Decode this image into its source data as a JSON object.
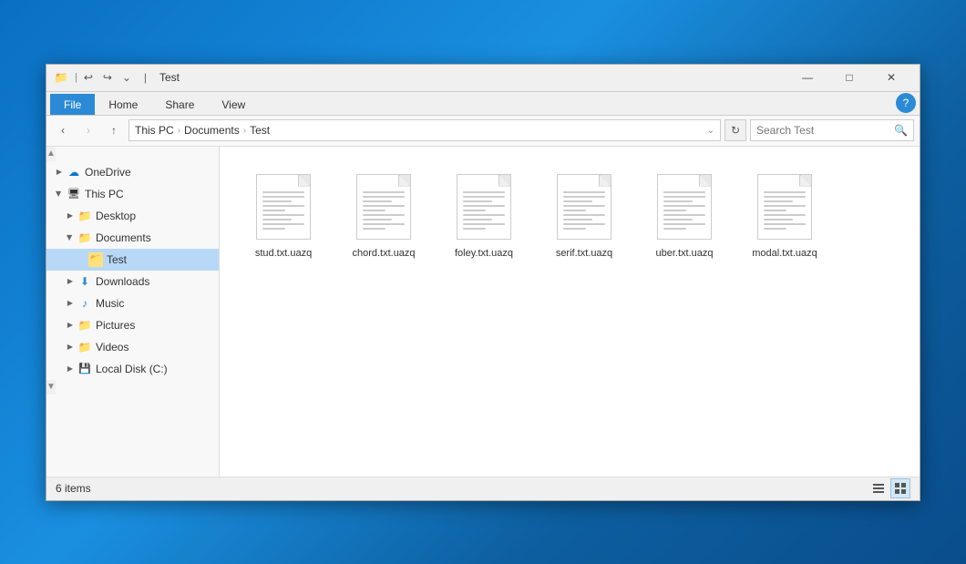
{
  "window": {
    "title": "Test",
    "title_icon": "📁"
  },
  "title_bar": {
    "quick_access": [
      "back",
      "forward",
      "down"
    ],
    "title": "Test"
  },
  "ribbon": {
    "tabs": [
      "File",
      "Home",
      "Share",
      "View"
    ],
    "active_tab": "File",
    "help_label": "?"
  },
  "nav": {
    "back_disabled": false,
    "forward_disabled": true,
    "up_disabled": false,
    "address": {
      "parts": [
        "This PC",
        "Documents",
        "Test"
      ],
      "separators": [
        "›",
        "›"
      ]
    },
    "search_placeholder": "Search Test"
  },
  "sidebar": {
    "items": [
      {
        "id": "onedrive",
        "label": "OneDrive",
        "indent": 1,
        "expanded": false,
        "icon": "cloud"
      },
      {
        "id": "thispc",
        "label": "This PC",
        "indent": 1,
        "expanded": true,
        "icon": "computer"
      },
      {
        "id": "desktop",
        "label": "Desktop",
        "indent": 2,
        "expanded": false,
        "icon": "folder"
      },
      {
        "id": "documents",
        "label": "Documents",
        "indent": 2,
        "expanded": true,
        "icon": "folder"
      },
      {
        "id": "test",
        "label": "Test",
        "indent": 3,
        "expanded": false,
        "icon": "folder",
        "selected": true
      },
      {
        "id": "downloads",
        "label": "Downloads",
        "indent": 2,
        "expanded": false,
        "icon": "downloads"
      },
      {
        "id": "music",
        "label": "Music",
        "indent": 2,
        "expanded": false,
        "icon": "music"
      },
      {
        "id": "pictures",
        "label": "Pictures",
        "indent": 2,
        "expanded": false,
        "icon": "folder"
      },
      {
        "id": "videos",
        "label": "Videos",
        "indent": 2,
        "expanded": false,
        "icon": "folder"
      },
      {
        "id": "localdisk",
        "label": "Local Disk (C:)",
        "indent": 2,
        "expanded": false,
        "icon": "drive"
      }
    ]
  },
  "files": [
    {
      "name": "stud.txt.uazq",
      "type": "text"
    },
    {
      "name": "chord.txt.uazq",
      "type": "text"
    },
    {
      "name": "foley.txt.uazq",
      "type": "text"
    },
    {
      "name": "serif.txt.uazq",
      "type": "text"
    },
    {
      "name": "uber.txt.uazq",
      "type": "text"
    },
    {
      "name": "modal.txt.uazq",
      "type": "text"
    }
  ],
  "status": {
    "item_count": "6 items"
  },
  "window_controls": {
    "minimize": "—",
    "maximize": "□",
    "close": "✕"
  }
}
